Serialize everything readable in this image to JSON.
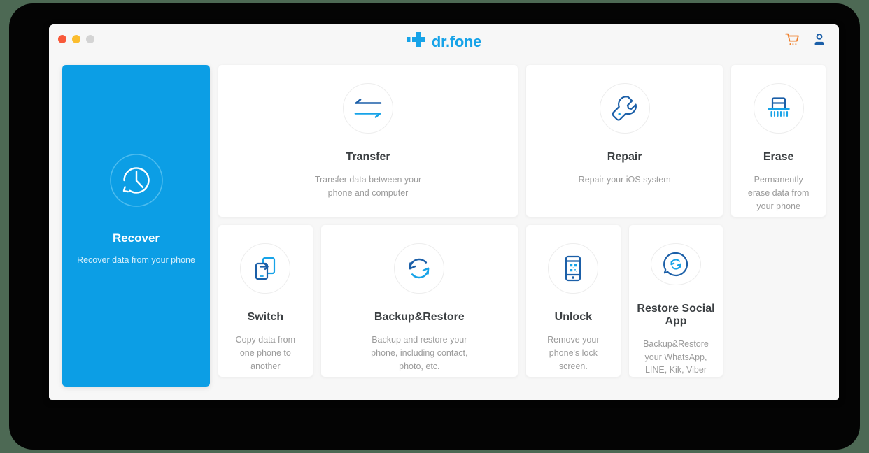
{
  "window": {
    "traffic_lights": [
      {
        "name": "close",
        "color": "#f8593a"
      },
      {
        "name": "minimize",
        "color": "#fbbd2e"
      },
      {
        "name": "zoom",
        "color": "#d4d4d4"
      }
    ],
    "brand_name": "dr.fone",
    "brand_color": "#17a3e8",
    "actions": [
      {
        "name": "cart-icon",
        "color": "#ef7f2a"
      },
      {
        "name": "account-icon",
        "color": "#1b5fa8"
      }
    ]
  },
  "featured": {
    "icon": "clock-restore-icon",
    "title": "Recover",
    "desc": "Recover data from your phone",
    "bg_color": "#0c9ee5",
    "selected": true
  },
  "tiles": [
    {
      "id": "transfer",
      "icon": "transfer-arrows-icon",
      "title": "Transfer",
      "desc": "Transfer data between your phone and computer"
    },
    {
      "id": "repair",
      "icon": "wrench-icon",
      "title": "Repair",
      "desc": "Repair your iOS system"
    },
    {
      "id": "erase",
      "icon": "shredder-icon",
      "title": "Erase",
      "desc": "Permanently erase data from your phone"
    },
    {
      "id": "switch",
      "icon": "two-phones-switch-icon",
      "title": "Switch",
      "desc": "Copy data from one phone to another"
    },
    {
      "id": "backup-restore",
      "icon": "circular-arrows-icon",
      "title": "Backup&Restore",
      "desc": "Backup and restore your phone, including contact, photo, etc."
    },
    {
      "id": "unlock",
      "icon": "phone-lock-screen-icon",
      "title": "Unlock",
      "desc": "Remove your phone's lock screen."
    },
    {
      "id": "restore-social-app",
      "icon": "chat-bubble-refresh-icon",
      "title": "Restore Social App",
      "desc": "Backup&Restore your WhatsApp, LINE, Kik, Viber"
    }
  ],
  "palette": {
    "page_bg": "#4d6954",
    "frame": "#040404",
    "window_bg": "#f7f7f7",
    "icon_dark_blue": "#1b5fa8",
    "icon_light_blue": "#17a3e8",
    "title_text": "#3c4043",
    "desc_text": "#9b9b9b"
  }
}
